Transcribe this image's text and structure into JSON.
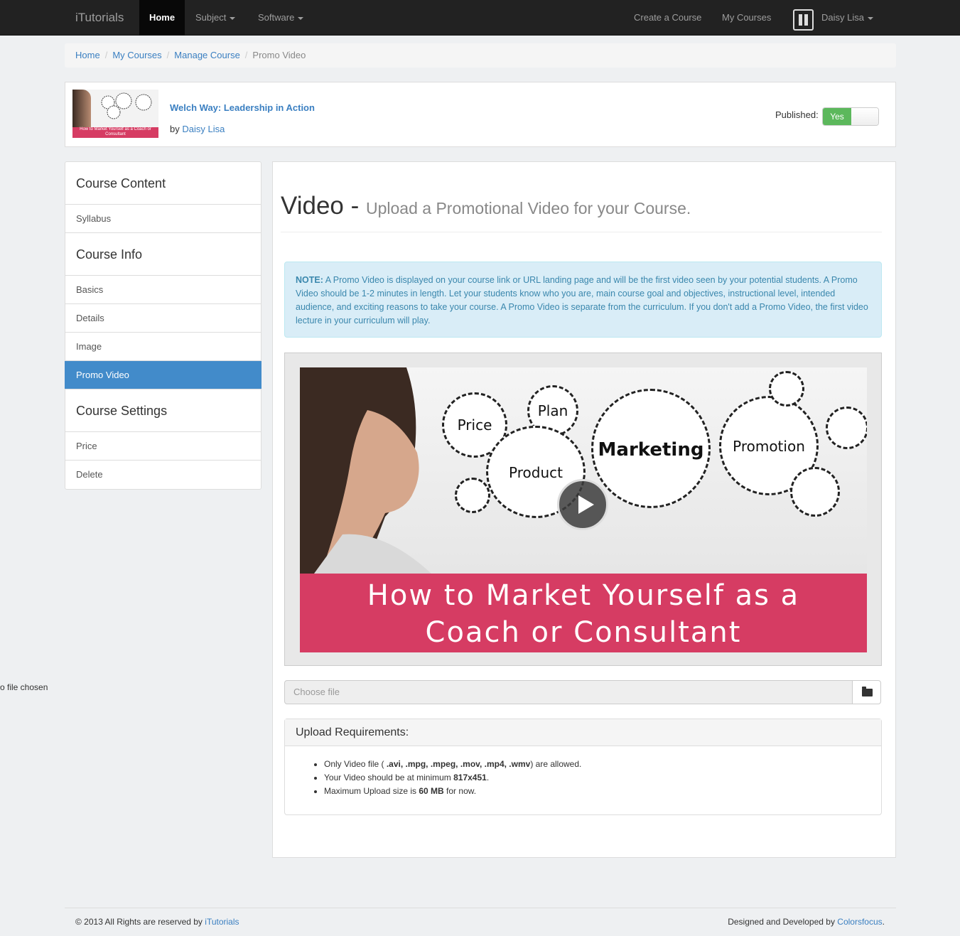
{
  "navbar": {
    "brand": "iTutorials",
    "home": "Home",
    "subject": "Subject",
    "software": "Software",
    "create_course": "Create a Course",
    "my_courses": "My Courses",
    "user": "Daisy Lisa"
  },
  "breadcrumb": [
    "Home",
    "My Courses",
    "Manage Course",
    "Promo Video"
  ],
  "course": {
    "title": "Welch Way: Leadership in Action",
    "by": "by",
    "author": "Daisy Lisa",
    "published_label": "Published:",
    "published_value": "Yes",
    "thumb_caption": "How to Market Yourself as a Coach or Consultant"
  },
  "sidebar": {
    "content_head": "Course Content",
    "syllabus": "Syllabus",
    "info_head": "Course Info",
    "basics": "Basics",
    "details": "Details",
    "image": "Image",
    "promo": "Promo Video",
    "settings_head": "Course Settings",
    "price": "Price",
    "delete": "Delete"
  },
  "main": {
    "heading": "Video -",
    "subheading": "Upload a Promotional Video for your Course.",
    "note_label": "NOTE:",
    "note_text": "A Promo Video is displayed on your course link or URL landing page and will be the first video seen by your potential students. A Promo Video should be 1-2 minutes in length. Let your students know who you are, main course goal and objectives, instructional level, intended audience, and exciting reasons to take your course. A Promo Video is separate from the curriculum. If you don't add a Promo Video, the first video lecture in your curriculum will play.",
    "video": {
      "gear_labels": [
        "Price",
        "Plan",
        "Marketing",
        "Promotion",
        "Product"
      ],
      "caption_line1": "How to Market Yourself as a",
      "caption_line2": "Coach or Consultant"
    },
    "file_placeholder": "Choose file",
    "no_file": "o file chosen",
    "req_head": "Upload Requirements:",
    "req": {
      "r1_a": "Only Video file ( ",
      "r1_b": ".avi, .mpg, .mpeg, .mov, .mp4, .wmv",
      "r1_c": ") are allowed.",
      "r2_a": "Your Video should be at minimum ",
      "r2_b": "817x451",
      "r2_c": ".",
      "r3_a": "Maximum Upload size is ",
      "r3_b": "60 MB",
      "r3_c": " for now."
    }
  },
  "footer": {
    "left_text": "© 2013 All Rights are reserved by ",
    "left_link": "iTutorials",
    "right_text": "Designed and Developed by ",
    "right_link": "Colorsfocus",
    "right_end": "."
  }
}
